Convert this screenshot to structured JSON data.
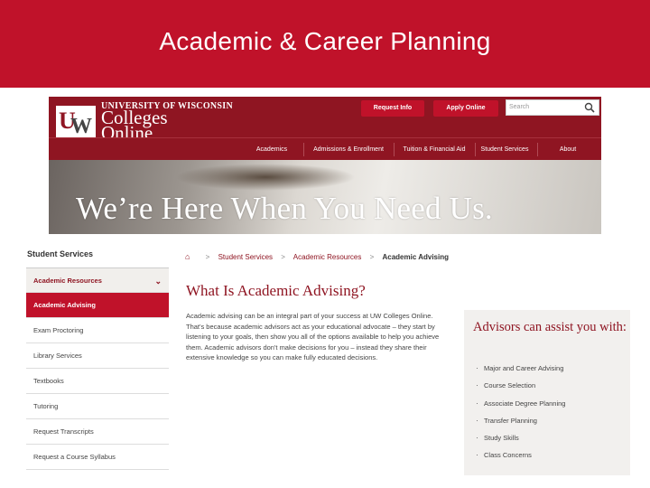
{
  "slide": {
    "title": "Academic & Career Planning"
  },
  "site_header": {
    "university": "UNIVERSITY OF WISCONSIN",
    "logo_line1": "Colleges",
    "logo_line2": "Online",
    "logo_u": "U",
    "logo_w": "W",
    "buttons": [
      "Request Info",
      "Apply Online"
    ],
    "search_placeholder": "Search",
    "nav": [
      "Academics",
      "Admissions & Enrollment",
      "Tuition & Financial Aid",
      "Student Services",
      "About"
    ]
  },
  "hero": {
    "text": "We’re Here When You Need Us."
  },
  "sidebar": {
    "title": "Student Services",
    "section": "Academic Resources",
    "items": [
      "Academic Advising",
      "Exam Proctoring",
      "Library Services",
      "Textbooks",
      "Tutoring",
      "Request Transcripts",
      "Request a Course Syllabus"
    ],
    "active_index": 0
  },
  "breadcrumb": [
    "Student Services",
    "Academic Resources",
    "Academic Advising"
  ],
  "content": {
    "title": "What Is Academic Advising?",
    "body": "Academic advising can be an integral part of your success at UW Colleges Online. That's because academic advisors act as your educational advocate – they start by listening to your goals, then show you all of the options available to help you achieve them. Academic advisors don't make decisions for you – instead they share their extensive knowledge so you can make fully educated decisions."
  },
  "assist": {
    "title": "Advisors can assist you with:",
    "items": [
      "Major and Career Advising",
      "Course Selection",
      "Associate Degree Planning",
      "Transfer Planning",
      "Study Skills",
      "Class Concerns"
    ]
  },
  "colors": {
    "banner": "#c0122a",
    "site_dark_red": "#8f1522",
    "assist_bg": "#f2f0ee"
  }
}
